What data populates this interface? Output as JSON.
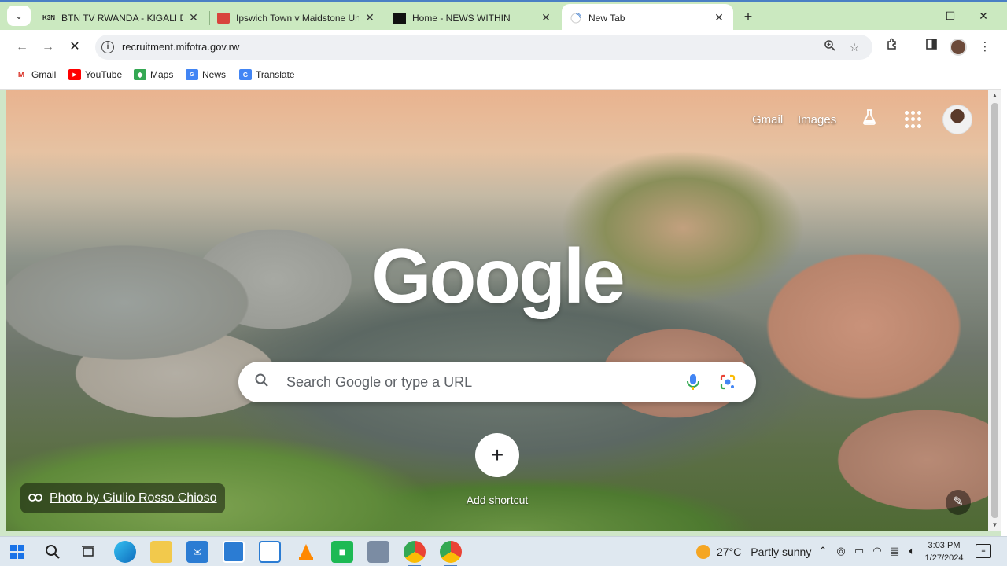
{
  "browser": {
    "tabs": [
      {
        "title": "BTN TV RWANDA - KIGALI DAIL",
        "favicon": "K3N",
        "active": false
      },
      {
        "title": "Ipswich Town v Maidstone Unit",
        "favicon": "",
        "active": false
      },
      {
        "title": "Home - NEWS WITHIN",
        "favicon": "",
        "active": false
      },
      {
        "title": "New Tab",
        "favicon": "",
        "active": true
      }
    ],
    "url": "recruitment.mifotra.gov.rw",
    "bookmarks": [
      {
        "label": "Gmail"
      },
      {
        "label": "YouTube"
      },
      {
        "label": "Maps"
      },
      {
        "label": "News"
      },
      {
        "label": "Translate"
      }
    ]
  },
  "newtab": {
    "gmail_link": "Gmail",
    "images_link": "Images",
    "logo": "Google",
    "search_placeholder": "Search Google or type a URL",
    "add_shortcut": "Add shortcut",
    "photo_credit": "Photo by Giulio Rosso Chioso"
  },
  "taskbar": {
    "temperature": "27°C",
    "weather": "Partly sunny",
    "time": "3:03 PM",
    "date": "1/27/2024"
  },
  "colors": {
    "tabstrip": "#cbe9c0",
    "accent": "#4a7fc4"
  }
}
